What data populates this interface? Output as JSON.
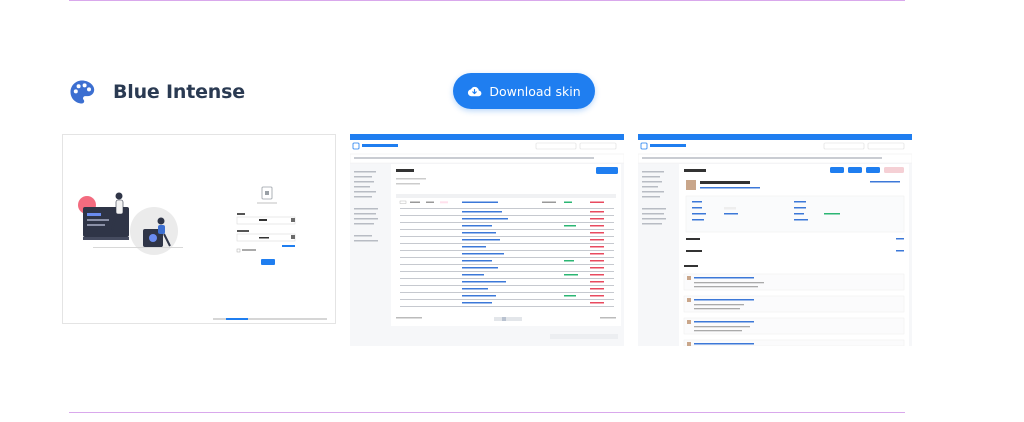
{
  "skin": {
    "name": "Blue Intense",
    "icon": "palette-icon",
    "download_label": "Download skin",
    "download_icon": "cloud-download-icon"
  },
  "colors": {
    "accent": "#1f7ef0",
    "title": "#2a3a52",
    "divider": "#d9a8ec",
    "palette_icon": "#3c6fd1"
  },
  "previews": [
    {
      "name": "login-preview",
      "screen_title": "Login"
    },
    {
      "name": "issues-preview",
      "app_title": "Best Redmine Theme",
      "heading": "Issues",
      "new_button": "+ New issue"
    },
    {
      "name": "issue-detail-preview",
      "app_title": "Best Redmine Theme",
      "heading": "Tracker 7 #51",
      "subject": "Agile plugin installation",
      "section_history": "History"
    }
  ]
}
